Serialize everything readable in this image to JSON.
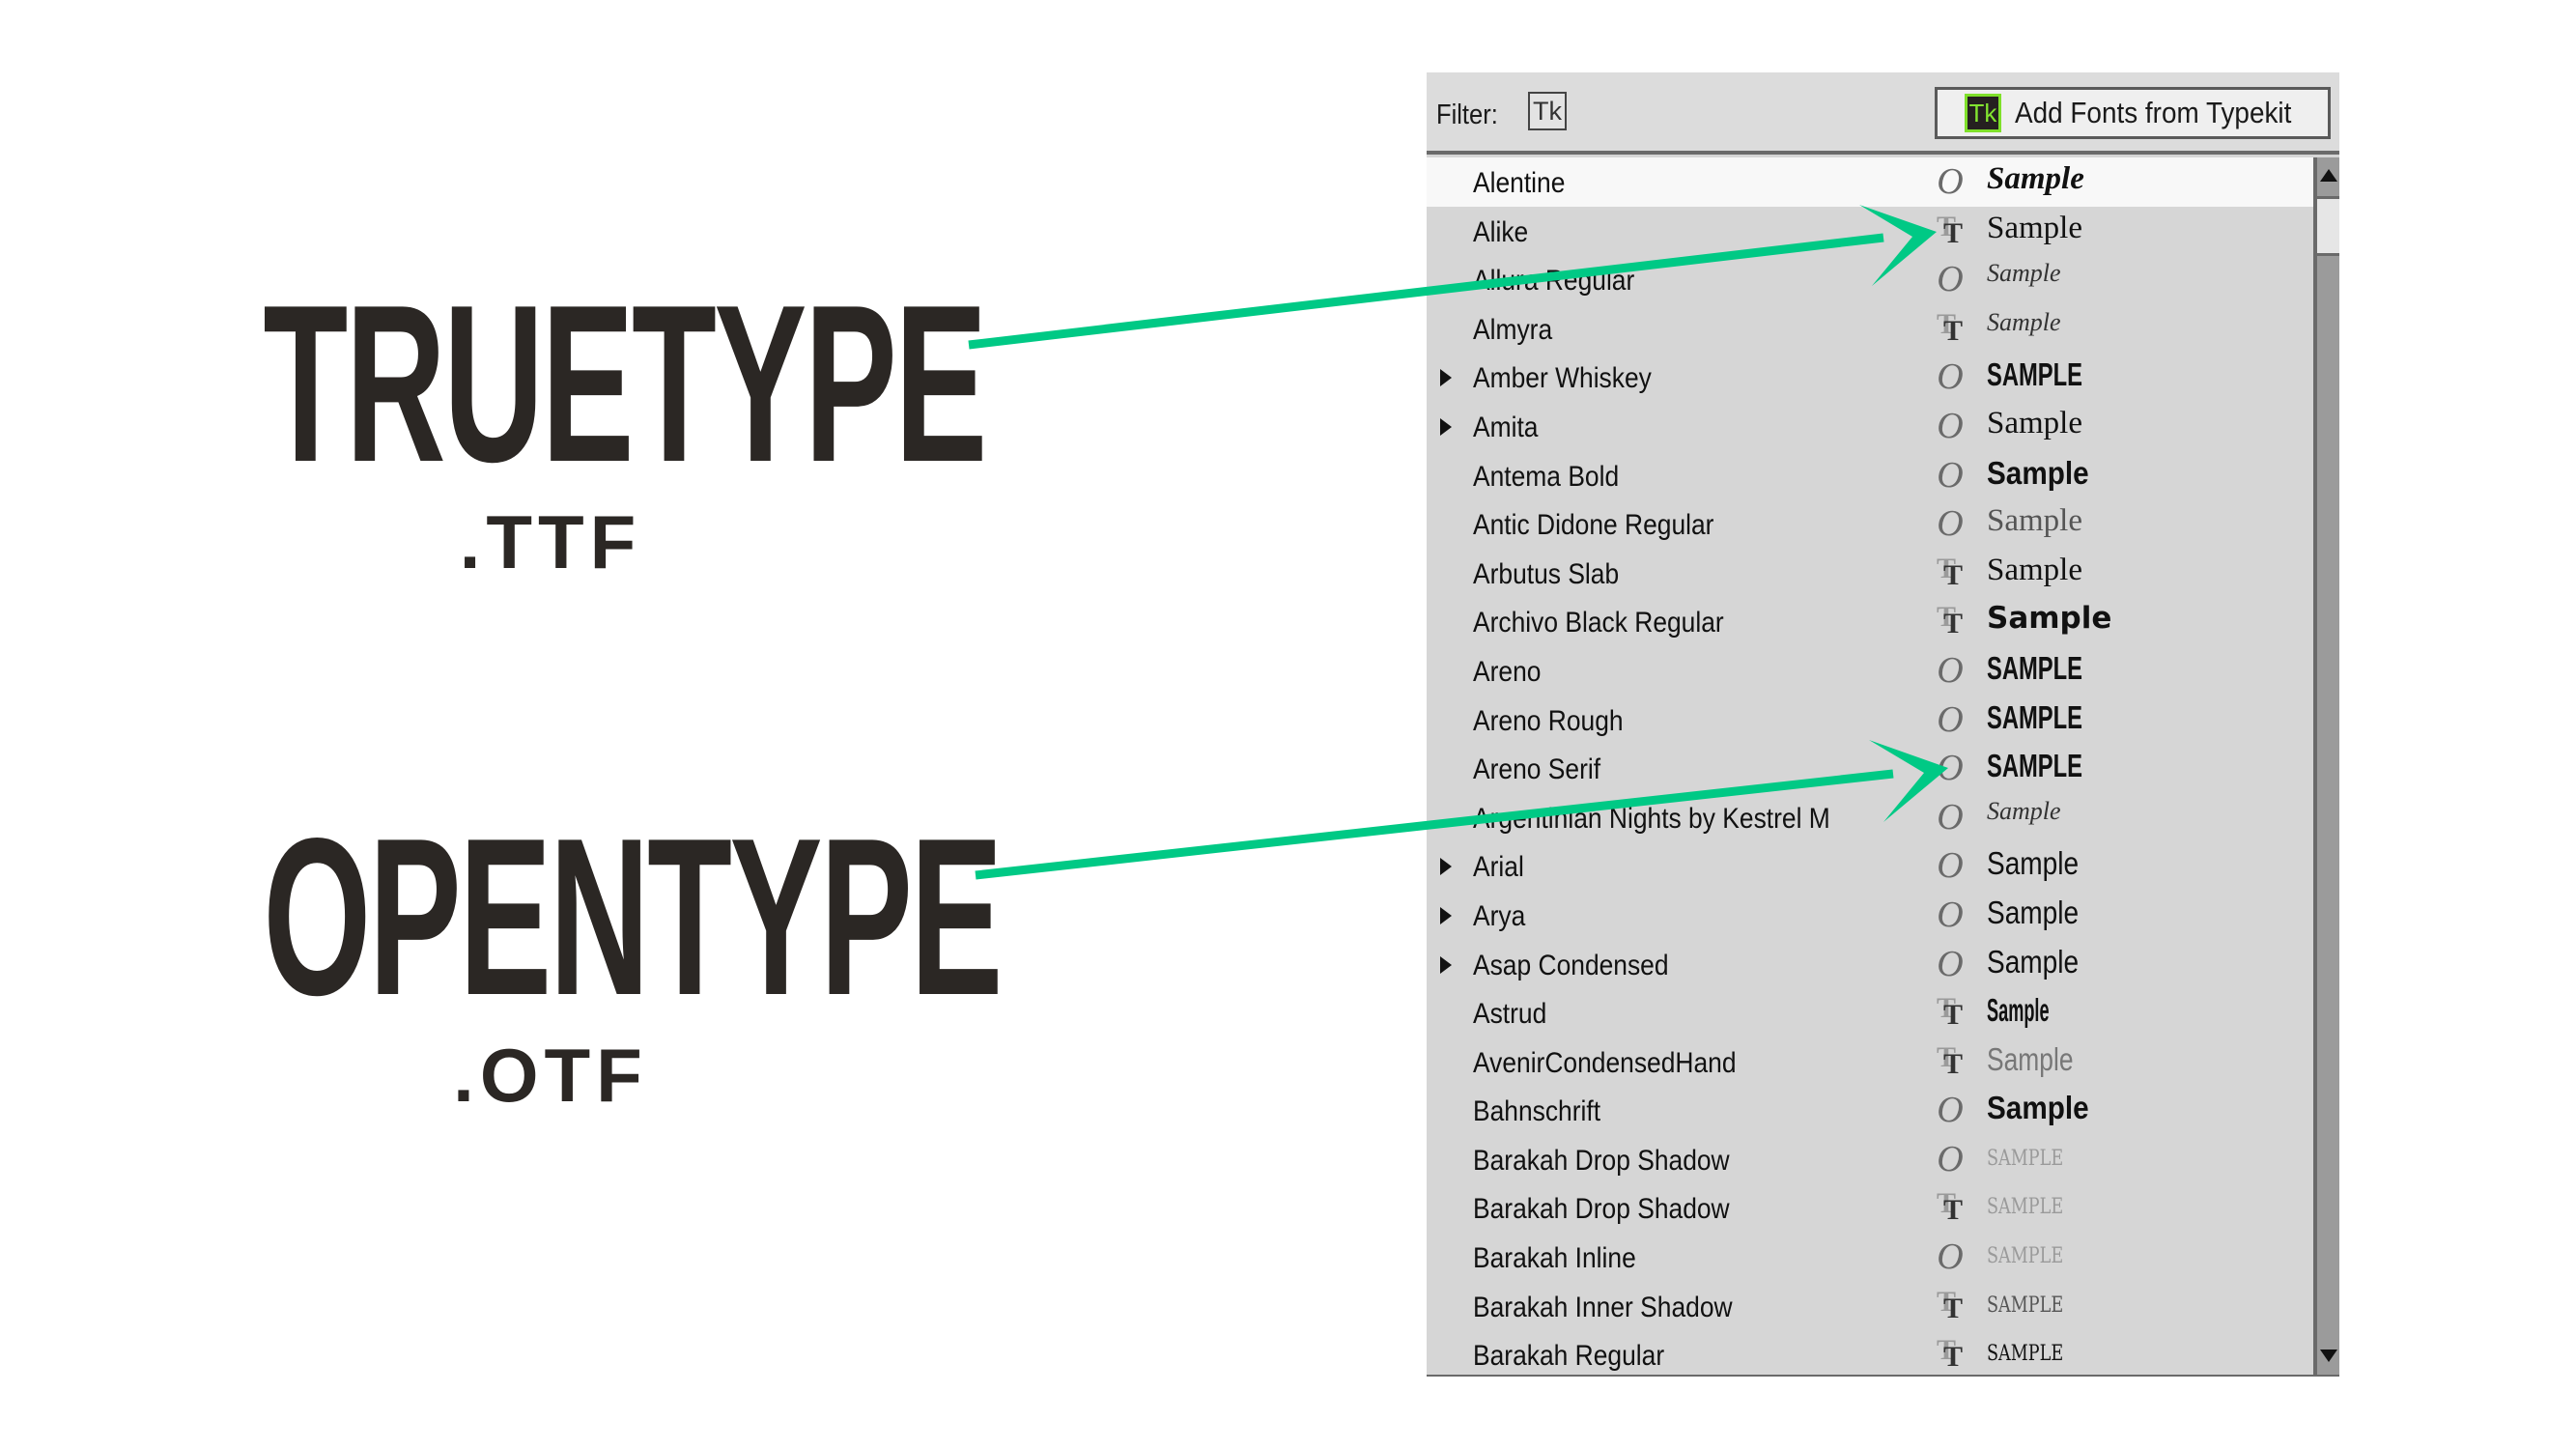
{
  "labels": {
    "truetype": {
      "title": "TRUETYPE",
      "extension": ".TTF"
    },
    "opentype": {
      "title": "OPENTYPE",
      "extension": ".OTF"
    }
  },
  "arrow_color": "#00c985",
  "panel": {
    "filter_label": "Filter:",
    "filter_typekit_icon": "Tk",
    "typekit_button": {
      "icon": "Tk",
      "label": "Add Fonts from Typekit"
    },
    "fonts": [
      {
        "name": "Alentine",
        "type": "otf",
        "expandable": false,
        "sample": "Sample",
        "style": "script",
        "selected": true
      },
      {
        "name": "Alike",
        "type": "ttf",
        "expandable": false,
        "sample": "Sample",
        "style": "serif"
      },
      {
        "name": "Allura Regular",
        "type": "otf",
        "expandable": false,
        "sample": "Sample",
        "style": "italic-light"
      },
      {
        "name": "Almyra",
        "type": "ttf",
        "expandable": false,
        "sample": "Sample",
        "style": "italic-light"
      },
      {
        "name": "Amber Whiskey",
        "type": "otf",
        "expandable": true,
        "sample": "SAMPLE",
        "style": "caps"
      },
      {
        "name": "Amita",
        "type": "otf",
        "expandable": true,
        "sample": "Sample",
        "style": "serif"
      },
      {
        "name": "Antema Bold",
        "type": "otf",
        "expandable": false,
        "sample": "Sample",
        "style": "bold"
      },
      {
        "name": "Antic Didone Regular",
        "type": "otf",
        "expandable": false,
        "sample": "Sample",
        "style": "grey"
      },
      {
        "name": "Arbutus Slab",
        "type": "ttf",
        "expandable": false,
        "sample": "Sample",
        "style": "serif"
      },
      {
        "name": "Archivo Black Regular",
        "type": "ttf",
        "expandable": false,
        "sample": "Sample",
        "style": "black"
      },
      {
        "name": "Areno",
        "type": "otf",
        "expandable": false,
        "sample": "SAMPLE",
        "style": "caps"
      },
      {
        "name": "Areno Rough",
        "type": "otf",
        "expandable": false,
        "sample": "SAMPLE",
        "style": "caps"
      },
      {
        "name": "Areno Serif",
        "type": "otf",
        "expandable": false,
        "sample": "SAMPLE",
        "style": "caps"
      },
      {
        "name": "Argentinian Nights by Kestrel M",
        "type": "otf",
        "expandable": false,
        "sample": "Sample",
        "style": "italic-light"
      },
      {
        "name": "Arial",
        "type": "otf",
        "expandable": true,
        "sample": "Sample",
        "style": "sans"
      },
      {
        "name": "Arya",
        "type": "otf",
        "expandable": true,
        "sample": "Sample",
        "style": "sans"
      },
      {
        "name": "Asap Condensed",
        "type": "otf",
        "expandable": true,
        "sample": "Sample",
        "style": "sans"
      },
      {
        "name": "Astrud",
        "type": "ttf",
        "expandable": false,
        "sample": "Sample",
        "style": "condensed"
      },
      {
        "name": "AvenirCondensedHand",
        "type": "ttf",
        "expandable": false,
        "sample": "Sample",
        "style": "light"
      },
      {
        "name": "Bahnschrift",
        "type": "otf",
        "expandable": false,
        "sample": "Sample",
        "style": "bold"
      },
      {
        "name": "Barakah Drop Shadow",
        "type": "otf",
        "expandable": false,
        "sample": "SAMPLE",
        "style": "deco-faint"
      },
      {
        "name": "Barakah Drop Shadow",
        "type": "ttf",
        "expandable": false,
        "sample": "SAMPLE",
        "style": "deco-faint"
      },
      {
        "name": "Barakah Inline",
        "type": "otf",
        "expandable": false,
        "sample": "SAMPLE",
        "style": "deco-faint"
      },
      {
        "name": "Barakah Inner Shadow",
        "type": "ttf",
        "expandable": false,
        "sample": "SAMPLE",
        "style": "deco-mid"
      },
      {
        "name": "Barakah Regular",
        "type": "ttf",
        "expandable": false,
        "sample": "SAMPLE",
        "style": "deco"
      }
    ]
  }
}
